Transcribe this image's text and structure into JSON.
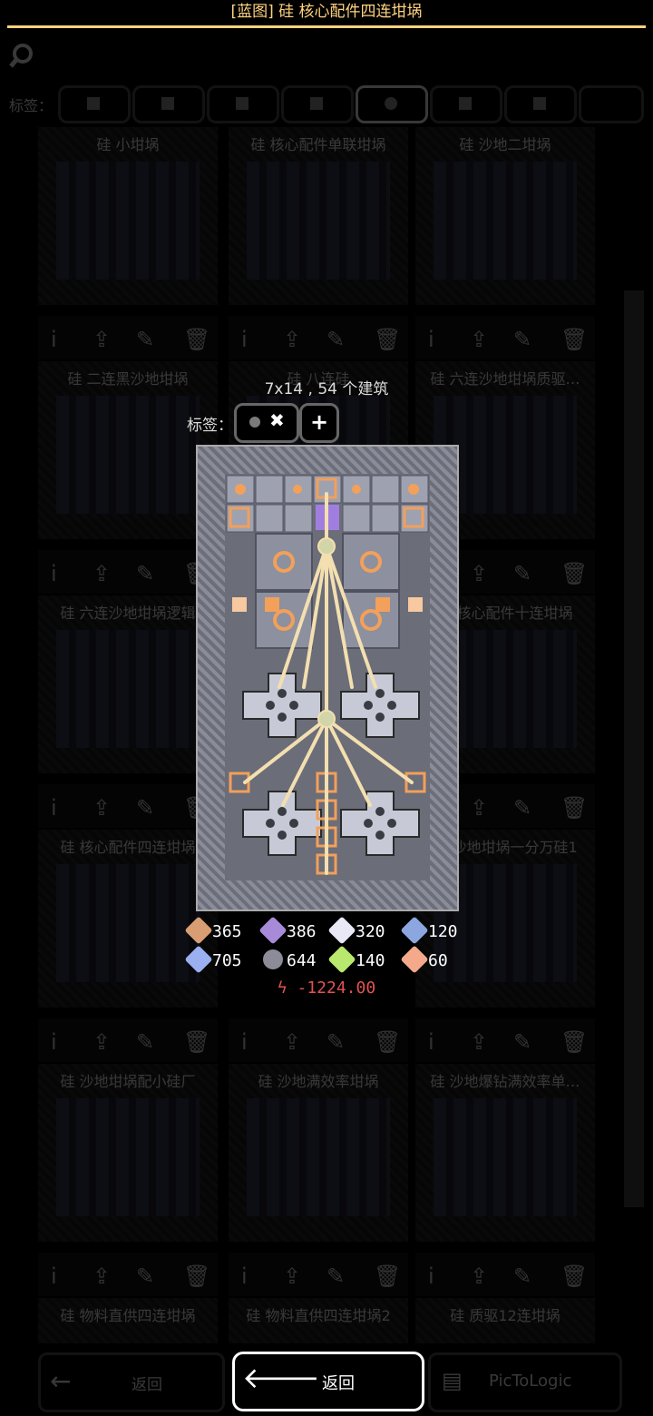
{
  "title": "[蓝图] 硅 核心配件四连坩埚",
  "search_icon": "search-icon",
  "tag_bar_label": "标签：",
  "cards": [
    {
      "name": "硅  小坩埚"
    },
    {
      "name": "硅  核心配件单联坩埚"
    },
    {
      "name": "硅  沙地二坩埚"
    },
    {
      "name": "硅 二连黑沙地坩埚"
    },
    {
      "name": "硅  八连硅"
    },
    {
      "name": "硅 六连沙地坩埚质驱…"
    },
    {
      "name": "硅 六连沙地坩埚逻辑"
    },
    {
      "name": "硅 核心配件十连坩埚"
    },
    {
      "name": "硅 核心配件四连坩埚"
    },
    {
      "name": "硅 沙地坩埚一分万硅1"
    },
    {
      "name": "硅 沙地坩埚配小硅厂"
    },
    {
      "name": "硅 沙地满效率坩埚"
    },
    {
      "name": "硅 沙地爆钻满效率单…"
    },
    {
      "name": "硅 物料直供四连坩埚"
    },
    {
      "name": "硅 物料直供四连坩埚2"
    },
    {
      "name": "硅 质驱12连坩埚"
    }
  ],
  "dialog": {
    "dimensions": "7x14 , 54 个建筑",
    "tag_label": "标签：",
    "tag_remove": "✖",
    "tag_add": "+",
    "resources": [
      {
        "name": "copper",
        "value": "365",
        "color": "#d99d73"
      },
      {
        "name": "plastanium",
        "value": "386",
        "color": "#a78bd8"
      },
      {
        "name": "metaglass",
        "value": "320",
        "color": "#e8e8f6"
      },
      {
        "name": "titanium",
        "value": "120",
        "color": "#8ca7e0"
      },
      {
        "name": "silicon",
        "value": "705",
        "color": "#9bb0f0"
      },
      {
        "name": "lead",
        "value": "644",
        "color": "#8c8c98"
      },
      {
        "name": "thorium-like",
        "value": "140",
        "color": "#b8e86e"
      },
      {
        "name": "surge",
        "value": "60",
        "color": "#f3a98a"
      }
    ],
    "power": "-1224.00"
  },
  "footer": {
    "back_dim": "返回",
    "back_main": "返回",
    "pictologic": "PicToLogic"
  }
}
